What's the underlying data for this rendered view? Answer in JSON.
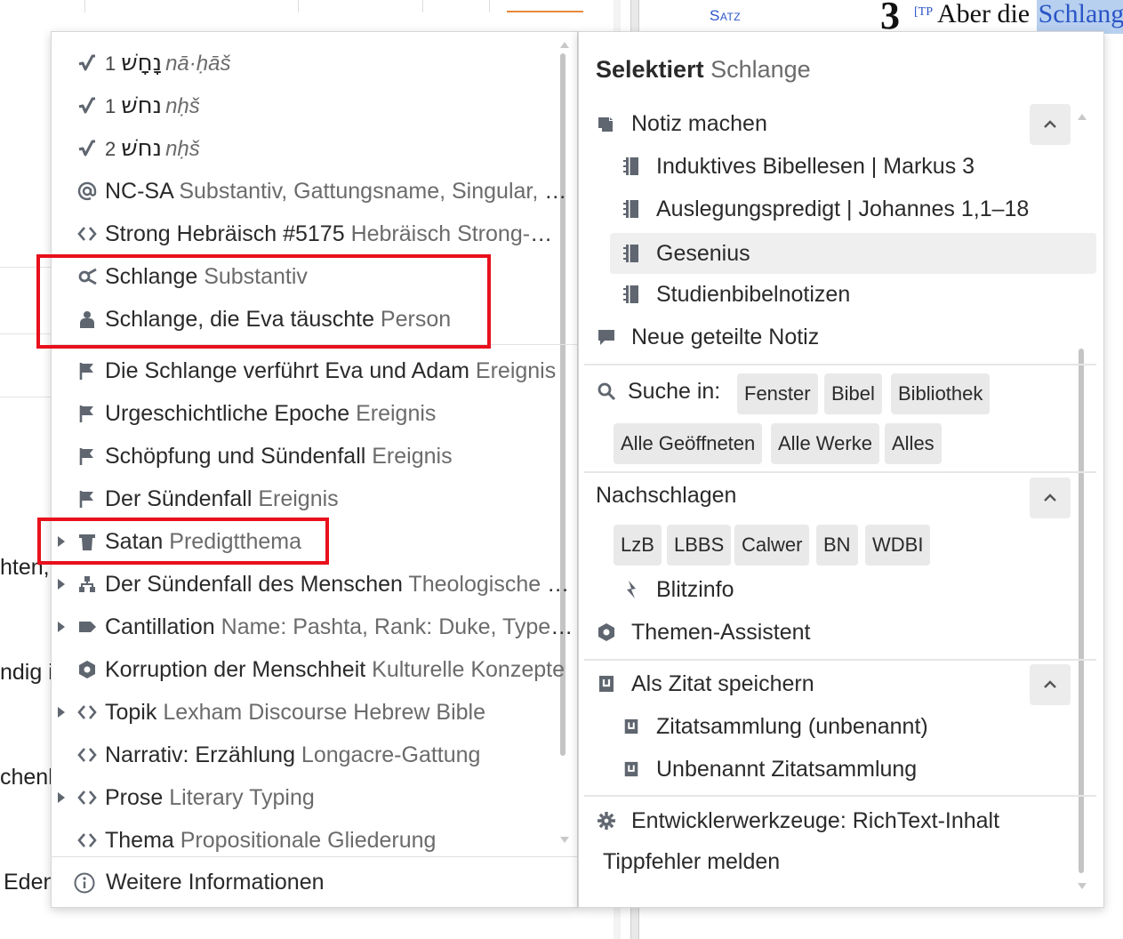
{
  "background": {
    "satz_label": "Satz",
    "verse_number": "3",
    "tp_marker": "[TP",
    "verse_text_before": "Aber die ",
    "verse_text_selected": "Schlange",
    "left_fragments": [
      "hten,",
      "ndig i",
      "chenk",
      "Eden"
    ]
  },
  "left_menu": {
    "rows": [
      {
        "heb_num": "1",
        "hebrew": "נָחָשׁ",
        "translit": "nā·ḥāš"
      },
      {
        "heb_num": "1",
        "hebrew": "נחשׁ",
        "translit": "nḥš"
      },
      {
        "heb_num": "2",
        "hebrew": "נחשׁ",
        "translit": "nḥš"
      },
      {
        "label": "NC-SA",
        "sub": " Substantiv, Gattungsname, Singular, absolut"
      },
      {
        "label": "Strong Hebräisch #5175",
        "sub": " Hebräisch Strong-Nummer"
      },
      {
        "label": "Schlange",
        "sub": " Substantiv"
      },
      {
        "label": "Schlange, die Eva täuschte",
        "sub": " Person"
      },
      {
        "label": "Die Schlange verführt Eva und Adam",
        "sub": " Ereignis"
      },
      {
        "label": "Urgeschichtliche Epoche",
        "sub": " Ereignis"
      },
      {
        "label": "Schöpfung und Sündenfall",
        "sub": " Ereignis"
      },
      {
        "label": "Der Sündenfall",
        "sub": " Ereignis"
      },
      {
        "label": "Satan",
        "sub": " Predigtthema"
      },
      {
        "label": "Der Sündenfall des Menschen",
        "sub": " Theologische Gliederung"
      },
      {
        "label": "Cantillation",
        "sub": " Name: Pashta, Rank: Duke, Type: Disjunctive"
      },
      {
        "label": "Korruption der Menschheit",
        "sub": " Kulturelle Konzepte"
      },
      {
        "label": "Topik",
        "sub": " Lexham Discourse Hebrew Bible"
      },
      {
        "label": "Narrativ: Erzählung",
        "sub": " Longacre-Gattung"
      },
      {
        "label": "Prose",
        "sub": " Literary Typing"
      },
      {
        "label": "Thema",
        "sub": " Propositionale Gliederung"
      }
    ],
    "footer_label": "Weitere Informationen"
  },
  "right_menu": {
    "title_bold": "Selektiert",
    "title_selection": "Schlange",
    "note": {
      "label": "Notiz machen",
      "items": [
        "Induktives Bibellesen | Markus 3",
        "Auslegungspredigt | Johannes 1,1–18",
        "Gesenius",
        "Studienbibelnotizen"
      ],
      "shared": "Neue geteilte Notiz"
    },
    "search": {
      "label": "Suche in:",
      "chips": [
        "Fenster",
        "Bibel",
        "Bibliothek",
        "Alle Geöffneten",
        "Alle Werke",
        "Alles"
      ]
    },
    "lookup": {
      "label": "Nachschlagen",
      "chips": [
        "LzB",
        "LBBS",
        "Calwer",
        "BN",
        "WDBI"
      ],
      "blitzinfo": "Blitzinfo",
      "themen": "Themen-Assistent"
    },
    "quote": {
      "label": "Als Zitat speichern",
      "items": [
        "Zitatsammlung (unbenannt)",
        "Unbenannt Zitatsammlung"
      ]
    },
    "dev": "Entwicklerwerkzeuge: RichText-Inhalt",
    "typo": "Tippfehler melden"
  },
  "colors": {
    "highlight_border": "#e8101c",
    "link_blue": "#2a55c7",
    "icon_gray": "#5f6670",
    "chip_bg": "#e9e9e9"
  }
}
